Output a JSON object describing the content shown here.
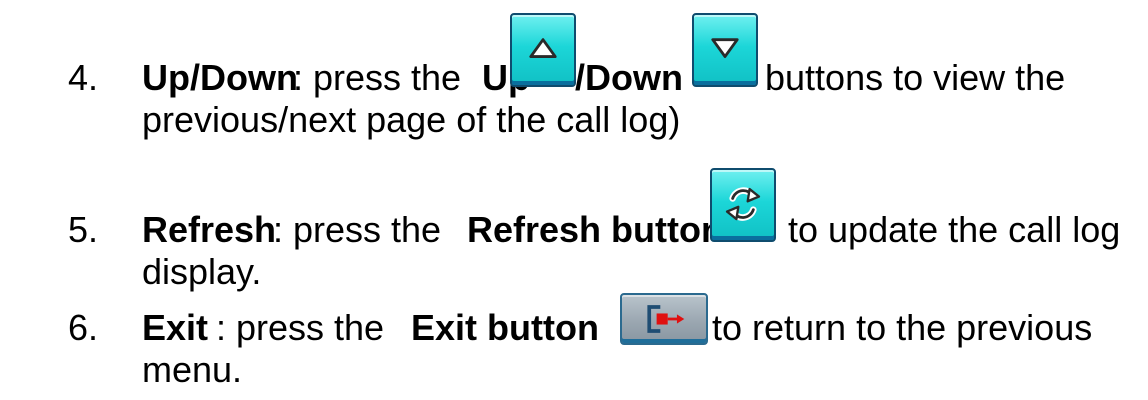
{
  "items": [
    {
      "number": "4.",
      "title": "Up/Down",
      "line1_a": ": press the ",
      "up_label": "Up",
      "down_label": "/Down",
      "line1_b": " buttons to view the",
      "line2": "previous/next page of the call log)"
    },
    {
      "number": "5.",
      "title": "Refresh",
      "line1_a": ": press the ",
      "button_label": "Refresh button",
      "line1_b": " to update the call log",
      "line2": "display."
    },
    {
      "number": "6.",
      "title": "Exit",
      "line1_a": ": press the ",
      "button_label": "Exit button",
      "line1_b": " to return to the previous",
      "line2": "menu."
    }
  ],
  "icons": {
    "up": "up-arrow-icon",
    "down": "down-arrow-icon",
    "refresh": "refresh-icon",
    "exit": "exit-icon"
  },
  "colors": {
    "button_cyan": "#1cd6d8",
    "button_gray": "#9ba7b1",
    "exit_arrow": "#e01010"
  }
}
